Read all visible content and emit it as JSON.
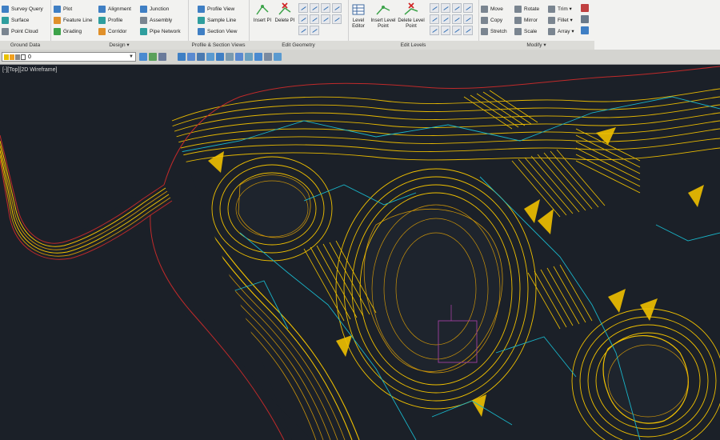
{
  "ribbon": {
    "ground_data": {
      "items": [
        "Survey Query",
        "Surface",
        "Point Cloud"
      ],
      "footer": "Ground Data"
    },
    "design": {
      "col1": [
        "Plot",
        "Feature Line",
        "Grading"
      ],
      "col2": [
        "Alignment",
        "Profile",
        "Corridor"
      ],
      "col3": [
        "Junction",
        "Assembly",
        "Pipe Network"
      ],
      "footer": "Design ▾"
    },
    "profile_section": {
      "items": [
        "Profile View",
        "Sample Line",
        "Section View"
      ],
      "footer": "Profile & Section Views"
    },
    "edit_geometry": {
      "big_buttons": [
        "Insert PI",
        "Delete PI"
      ],
      "footer": "Edit Geometry"
    },
    "edit_levels": {
      "big_buttons": [
        "Level Editor",
        "Insert Level Point",
        "Delete Level Point"
      ],
      "footer": "Edit Levels"
    },
    "modify": {
      "col1": [
        "Move",
        "Copy",
        "Stretch"
      ],
      "col2": [
        "Rotate",
        "Mirror",
        "Scale"
      ],
      "col3": [
        "Trim ▾",
        "Fillet ▾",
        "Array ▾"
      ],
      "footer": "Modify ▾"
    }
  },
  "toolbar": {
    "layer_value": "0"
  },
  "viewport": {
    "label": "[-][Top][2D Wireframe]"
  },
  "colors": {
    "background": "#1b2028",
    "contour_yellow": "#f0c000",
    "contour_orange": "#c8920a",
    "contour_cyan": "#19b4c8",
    "boundary_red": "#c02a2a",
    "magenta": "#a040a0"
  }
}
